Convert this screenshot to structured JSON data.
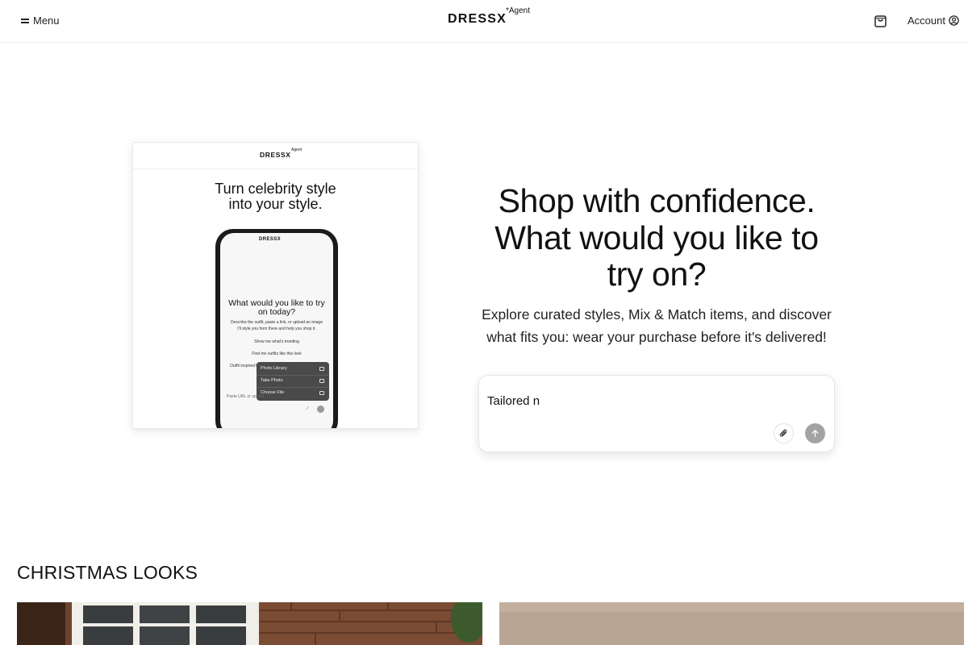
{
  "header": {
    "menu_label": "Menu",
    "logo": "DRESSX",
    "logo_sup": "*Agent",
    "account_label": "Account"
  },
  "promo": {
    "logo": "DRESSX",
    "logo_sup": "Agent",
    "headline_line1": "Turn celebrity style",
    "headline_line2": "into your style.",
    "phone": {
      "logo": "DRESSX",
      "title_line1": "What would you like to try",
      "title_line2": "on today?",
      "desc_line1": "Describe the outfit, paste a link, or upload an image",
      "desc_line2": "I'll style you from there and help you shop it.",
      "chip1": "Show me what's trending",
      "chip2": "Find me outfits like this look",
      "chip3": "Outfit inspired by...",
      "menu_items": [
        "Photo Library",
        "Take Photo",
        "Choose File"
      ],
      "input_placeholder": "Paste URL or upload"
    }
  },
  "hero": {
    "title_line1": "Shop with confidence.",
    "title_line2": "What would you like to",
    "title_line3": "try on?",
    "subtitle_line1": "Explore curated styles, Mix & Match items, and discover",
    "subtitle_line2": "what fits you: wear your purchase before it's delivered!"
  },
  "chat": {
    "value": "Tailored n"
  },
  "section": {
    "title": "CHRISTMAS LOOKS"
  },
  "colors": {
    "send_button": "#a3a3a3",
    "look1_bg": "#5c3a28",
    "look2_bg": "#b9a593"
  },
  "icons": {
    "menu": "hamburger-icon",
    "cart": "shopping-bag-icon",
    "account": "user-circle-icon",
    "attach": "paperclip-icon",
    "send": "arrow-up-icon"
  }
}
